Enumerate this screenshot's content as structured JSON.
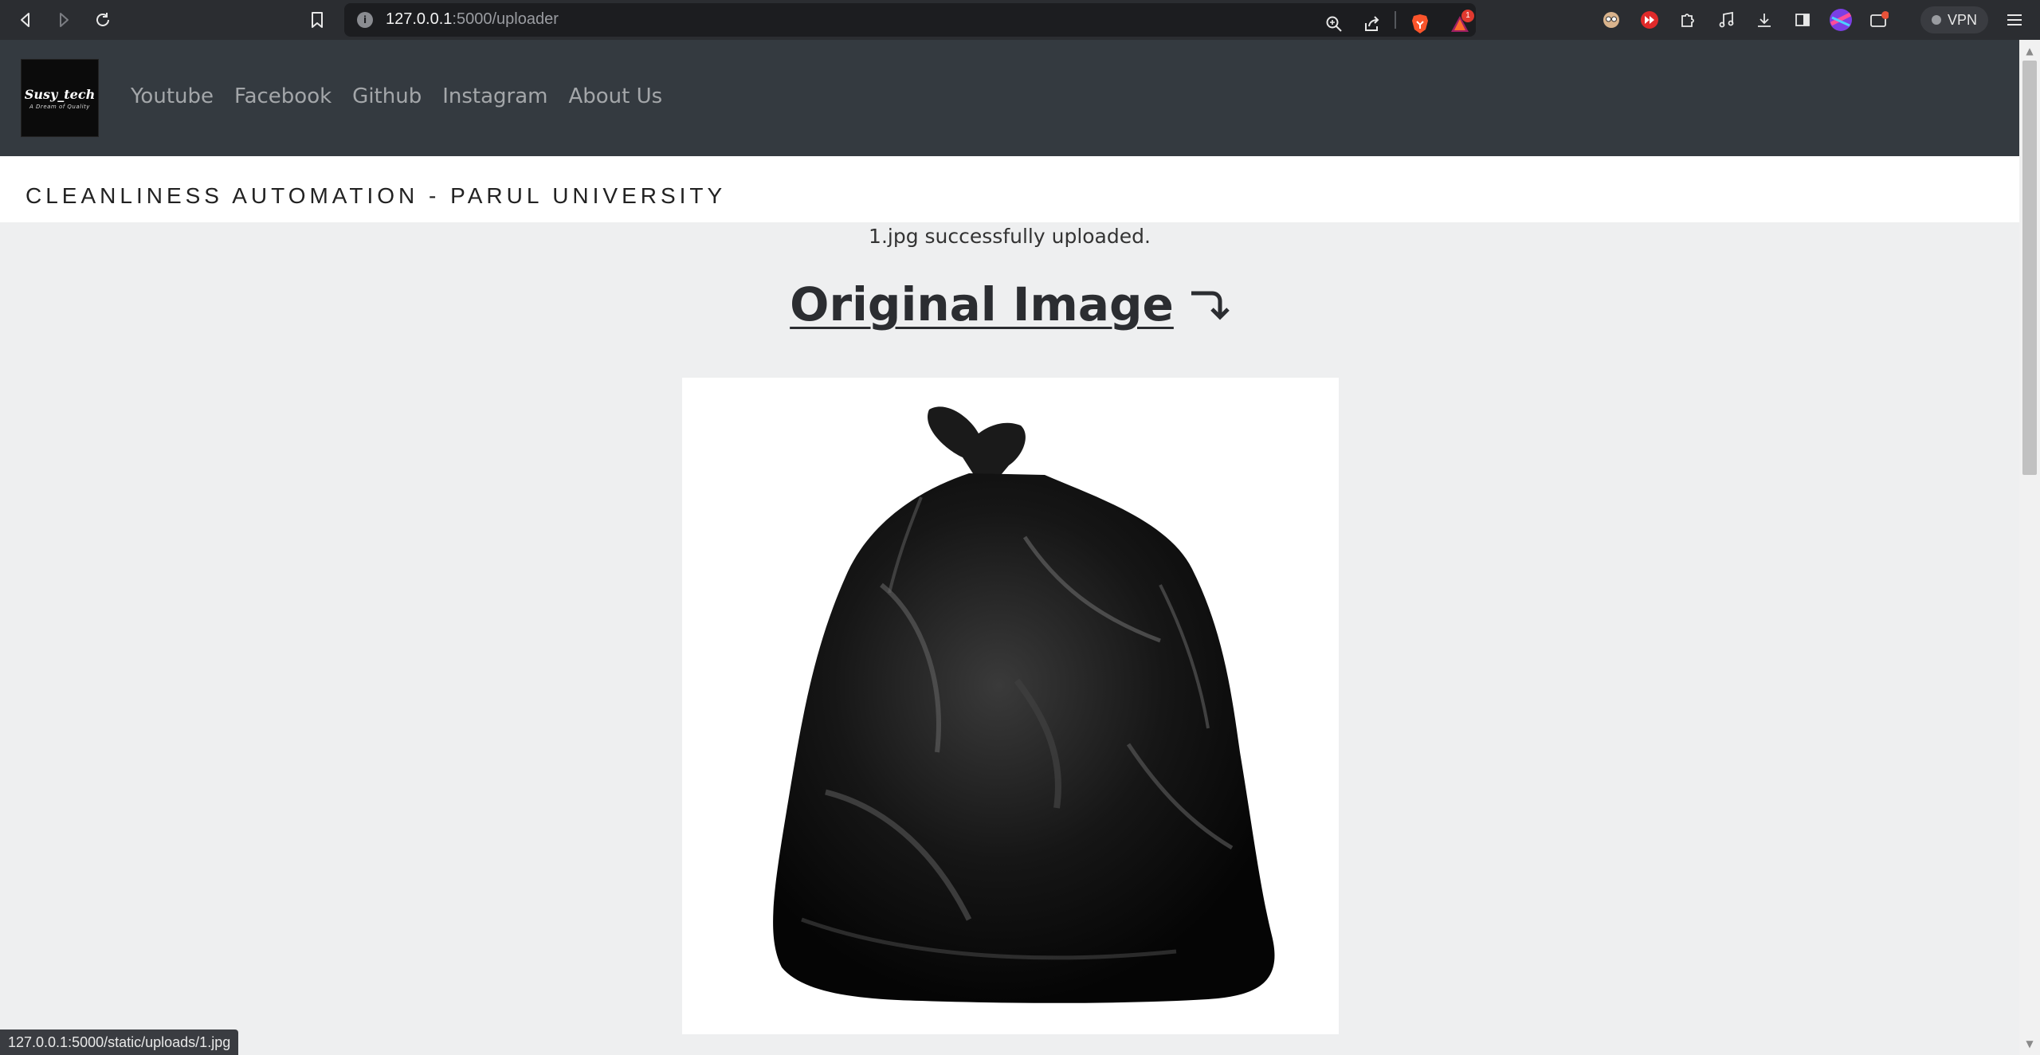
{
  "browser": {
    "url_host": "127.0.0.1",
    "url_path": ":5000/uploader",
    "rewards_badge": "1",
    "vpn_label": "VPN"
  },
  "site_nav": {
    "logo_main": "Susy_tech",
    "logo_sub": "A Dream of Quality",
    "links": [
      "Youtube",
      "Facebook",
      "Github",
      "Instagram",
      "About Us"
    ]
  },
  "header": {
    "title": "CLEANLINESS AUTOMATION - PARUL UNIVERSITY"
  },
  "main": {
    "upload_message": "1.jpg successfully uploaded.",
    "section_heading": "Original Image"
  },
  "status_bar": {
    "link_preview": "127.0.0.1:5000/static/uploads/1.jpg"
  },
  "colors": {
    "navbar_bg": "#343a40",
    "page_bg": "#eeeff0",
    "chrome_bg": "#2b2d31"
  }
}
